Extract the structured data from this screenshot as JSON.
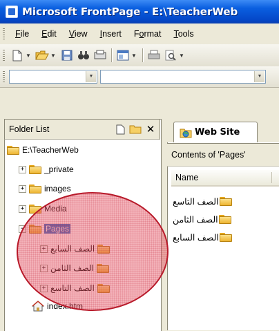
{
  "window": {
    "title": "Microsoft FrontPage - E:\\TeacherWeb"
  },
  "menubar": {
    "items": [
      {
        "label": "File",
        "key": "F",
        "rest": "ile"
      },
      {
        "label": "Edit",
        "key": "E",
        "rest": "dit"
      },
      {
        "label": "View",
        "key": "V",
        "rest": "iew"
      },
      {
        "label": "Insert",
        "key": "I",
        "rest": "nsert"
      },
      {
        "label": "Format",
        "pre": "F",
        "key": "o",
        "rest": "rmat"
      },
      {
        "label": "Tools",
        "key": "T",
        "rest": "ools"
      }
    ]
  },
  "folder_list": {
    "header": "Folder List",
    "root": "E:\\TeacherWeb",
    "items": [
      {
        "label": "_private",
        "expander": "+"
      },
      {
        "label": "images",
        "expander": "+"
      },
      {
        "label": "Media",
        "expander": "+"
      },
      {
        "label": "Pages",
        "expander": "−",
        "selected": true
      },
      {
        "label": "الصف السابع",
        "expander": "+"
      },
      {
        "label": "الصف الثامن",
        "expander": "+"
      },
      {
        "label": "الصف التاسع",
        "expander": "+"
      },
      {
        "label": "index.htm"
      }
    ]
  },
  "web_site": {
    "tab_label": "Web Site",
    "contents_label": "Contents of 'Pages'",
    "column_name": "Name",
    "files": [
      "الصف التاسع",
      "الصف الثامن",
      "الصف السابع"
    ]
  },
  "colors": {
    "titlebar": "#0a5fe0",
    "selection": "#316ac5",
    "annotation": "#d62a3c"
  }
}
